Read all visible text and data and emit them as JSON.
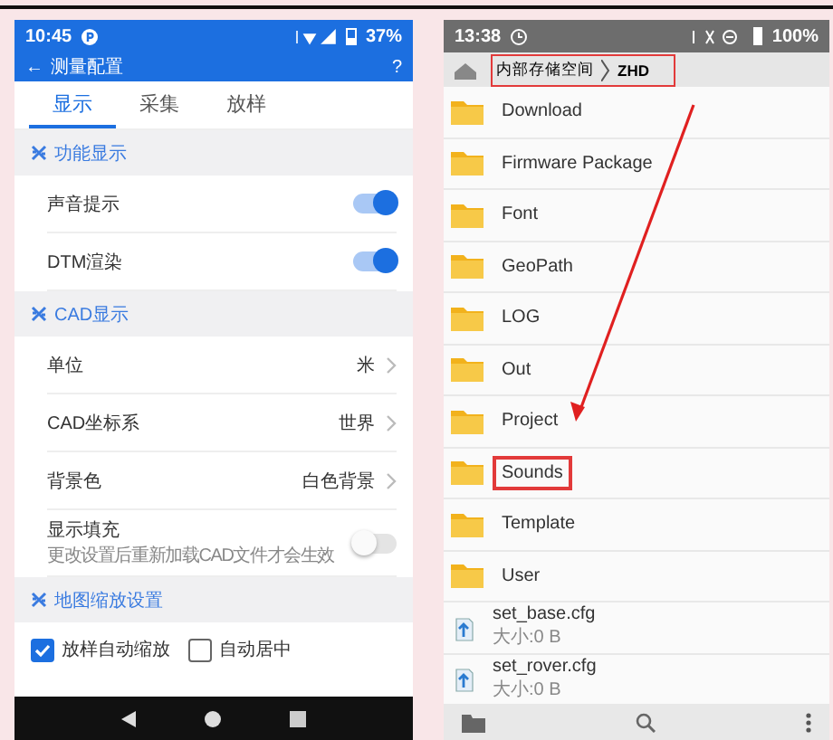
{
  "left": {
    "status_bar": {
      "time": "10:45",
      "battery": "37%"
    },
    "toolbar": {
      "back": "←",
      "title": "测量配置",
      "help": "?"
    },
    "tabs": [
      {
        "label": "显示",
        "selected": true
      },
      {
        "label": "采集",
        "selected": false
      },
      {
        "label": "放样",
        "selected": false
      }
    ],
    "sections": [
      {
        "title": "功能显示",
        "items": [
          {
            "kind": "toggle",
            "label": "声音提示",
            "on": true
          },
          {
            "kind": "toggle",
            "label": "DTM渲染",
            "on": true
          }
        ]
      },
      {
        "title": "CAD显示",
        "items": [
          {
            "kind": "value",
            "label": "单位",
            "value": "米"
          },
          {
            "kind": "value",
            "label": "CAD坐标系",
            "value": "世界"
          },
          {
            "kind": "value",
            "label": "背景色",
            "value": "白色背景"
          },
          {
            "kind": "toggle",
            "label": "显示填充",
            "hint": "更改设置后重新加载CAD文件才会生效",
            "on": false
          }
        ]
      },
      {
        "title": "地图缩放设置",
        "items": [
          {
            "kind": "checkbox",
            "label": "放样自动缩放",
            "checked": true
          },
          {
            "kind": "checkbox",
            "label": "自动居中",
            "checked": false
          }
        ]
      }
    ]
  },
  "right": {
    "status_bar": {
      "time": "13:38",
      "battery": "100%"
    },
    "breadcrumb": {
      "highlighted": true,
      "items": [
        "内部存储空间",
        "ZHD"
      ]
    },
    "files": [
      {
        "kind": "folder",
        "name": "Download",
        "highlighted": false
      },
      {
        "kind": "folder",
        "name": "Firmware Package",
        "highlighted": false
      },
      {
        "kind": "folder",
        "name": "Font",
        "highlighted": false
      },
      {
        "kind": "folder",
        "name": "GeoPath",
        "highlighted": false
      },
      {
        "kind": "folder",
        "name": "LOG",
        "highlighted": false
      },
      {
        "kind": "folder",
        "name": "Out",
        "highlighted": false
      },
      {
        "kind": "folder",
        "name": "Project",
        "highlighted": false
      },
      {
        "kind": "folder",
        "name": "Sounds",
        "highlighted": true
      },
      {
        "kind": "folder",
        "name": "Template",
        "highlighted": false
      },
      {
        "kind": "folder",
        "name": "User",
        "highlighted": false
      },
      {
        "kind": "file",
        "name": "set_base.cfg",
        "size": "大小:0 B",
        "highlighted": false
      },
      {
        "kind": "file",
        "name": "set_rover.cfg",
        "size": "大小:0 B",
        "highlighted": false
      }
    ]
  }
}
